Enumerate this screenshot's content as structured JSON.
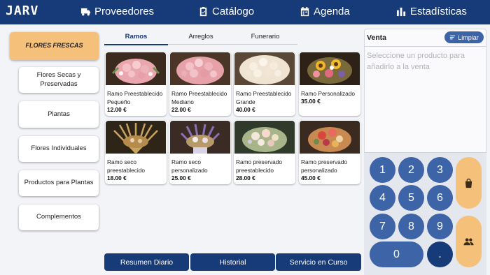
{
  "app": {
    "logo": "JARV"
  },
  "nav": [
    {
      "label": "Proveedores",
      "icon": "truck-icon"
    },
    {
      "label": "Catálogo",
      "icon": "clipboard-icon"
    },
    {
      "label": "Agenda",
      "icon": "calendar-icon"
    },
    {
      "label": "Estadísticas",
      "icon": "bar-chart-icon"
    }
  ],
  "categories": [
    {
      "label": "FLORES FRESCAS",
      "active": true
    },
    {
      "label": "Flores Secas y Preservadas"
    },
    {
      "label": "Plantas"
    },
    {
      "label": "Flores Individuales"
    },
    {
      "label": "Productos para Plantas"
    },
    {
      "label": "Complementos"
    }
  ],
  "tabs": [
    {
      "label": "Ramos",
      "active": true
    },
    {
      "label": "Arreglos"
    },
    {
      "label": "Funerario"
    }
  ],
  "products": [
    {
      "name": "Ramo Preestablecido Pequeño",
      "price": "12.00 €",
      "image": "pink-roses-bouquet-photo"
    },
    {
      "name": "Ramo Preestablecido Mediano",
      "price": "22.00 €",
      "image": "pink-roses-bouquet-photo"
    },
    {
      "name": "Ramo Preestablecido Grande",
      "price": "40.00 €",
      "image": "white-roses-bouquet-photo"
    },
    {
      "name": "Ramo Personalizado",
      "price": "35.00 €",
      "image": "sunflower-bouquet-photo"
    },
    {
      "name": "Ramo seco preestablecido",
      "price": "18.00 €",
      "image": "dried-wheat-bouquet-photo"
    },
    {
      "name": "Ramo seco personalizado",
      "price": "25.00 €",
      "image": "dried-lavender-bouquet-photo"
    },
    {
      "name": "Ramo preservado preestablecido",
      "price": "28.00 €",
      "image": "preserved-pastel-bouquet-photo"
    },
    {
      "name": "Ramo preservado personalizado",
      "price": "45.00 €",
      "image": "preserved-red-bouquet-photo"
    }
  ],
  "bottom_buttons": [
    {
      "label": "Resumen Diario"
    },
    {
      "label": "Historial"
    },
    {
      "label": "Servicio en Curso"
    }
  ],
  "sale": {
    "title": "Venta",
    "clear_label": "Limpiar",
    "hint": "Seleccione un producto para añadirlo a la venta"
  },
  "keypad": {
    "keys": [
      "1",
      "2",
      "3",
      "4",
      "5",
      "6",
      "7",
      "8",
      "9",
      "0",
      "."
    ],
    "side_buttons": [
      {
        "icon": "shopping-bag-icon"
      },
      {
        "icon": "people-icon"
      }
    ]
  },
  "colors": {
    "primary": "#173a78",
    "key": "#3d64a7",
    "accent": "#f5c07a",
    "background": "#f3f4f8"
  }
}
